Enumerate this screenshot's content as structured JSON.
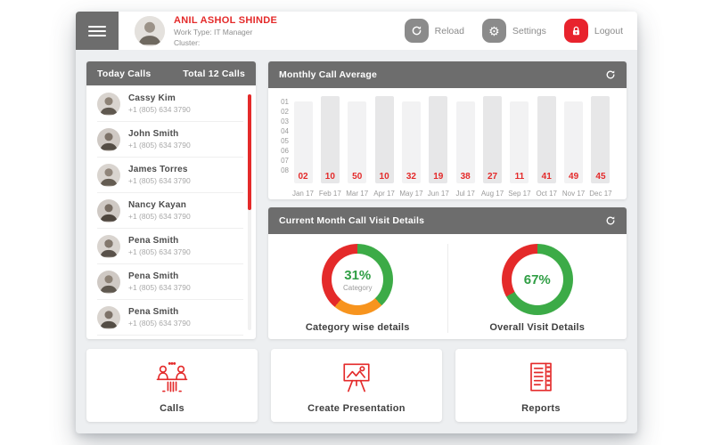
{
  "colors": {
    "accent_red": "#e42a2a",
    "logout_red": "#e8232d",
    "panel_header_gray": "#6d6d6d",
    "green": "#3cab47",
    "orange": "#f7941e",
    "body_bg": "#edeff1"
  },
  "header": {
    "user": {
      "name": "ANIL ASHOL SHINDE",
      "work_type": "Work Type: IT Manager",
      "cluster": "Cluster:"
    },
    "reload_label": "Reload",
    "settings_label": "Settings",
    "logout_label": "Logout"
  },
  "today_calls": {
    "title": "Today Calls",
    "total_label": "Total 12 Calls",
    "contacts": [
      {
        "name": "Cassy Kim",
        "phone": "+1 (805) 634 3790"
      },
      {
        "name": "John Smith",
        "phone": "+1 (805) 634 3790"
      },
      {
        "name": "James Torres",
        "phone": "+1 (805) 634 3790"
      },
      {
        "name": "Nancy Kayan",
        "phone": "+1 (805) 634 3790"
      },
      {
        "name": "Pena Smith",
        "phone": "+1 (805) 634 3790"
      },
      {
        "name": "Pena Smith",
        "phone": "+1 (805) 634 3790"
      },
      {
        "name": "Pena Smith",
        "phone": "+1 (805) 634 3790"
      }
    ]
  },
  "visit_details": {
    "title": "Current Month Call Visit Details"
  },
  "chart_data": [
    {
      "type": "bar",
      "title": "Monthly Call Average",
      "categories": [
        "Jan 17",
        "Feb 17",
        "Mar 17",
        "Apr 17",
        "May 17",
        "Jun 17",
        "Jul 17",
        "Aug 17",
        "Sep 17",
        "Oct 17",
        "Nov 17",
        "Dec 17"
      ],
      "values": [
        2,
        10,
        50,
        10,
        32,
        19,
        38,
        27,
        11,
        41,
        49,
        45
      ],
      "value_labels": [
        "02",
        "10",
        "50",
        "10",
        "32",
        "19",
        "38",
        "27",
        "11",
        "41",
        "49",
        "45"
      ],
      "y_ticks": [
        "01",
        "02",
        "03",
        "04",
        "05",
        "06",
        "07",
        "08"
      ],
      "xlabel": "",
      "ylabel": "",
      "legend_position": "none",
      "grid": false
    },
    {
      "type": "pie",
      "title": "Category wise details",
      "center_label": "31%",
      "center_sub": "Category",
      "slices": [
        {
          "label": "green segment",
          "value": 38,
          "color": "#3cab47"
        },
        {
          "label": "orange segment",
          "value": 23,
          "color": "#f7941e"
        },
        {
          "label": "red segment",
          "value": 39,
          "color": "#e42a2a"
        }
      ]
    },
    {
      "type": "pie",
      "title": "Overall Visit Details",
      "center_label": "67%",
      "center_sub": "",
      "slices": [
        {
          "label": "green segment",
          "value": 67,
          "color": "#3cab47"
        },
        {
          "label": "red segment",
          "value": 33,
          "color": "#e42a2a"
        }
      ]
    }
  ],
  "quick_actions": [
    {
      "label": "Calls",
      "icon": "meeting-icon"
    },
    {
      "label": "Create Presentation",
      "icon": "presentation-icon"
    },
    {
      "label": "Reports",
      "icon": "reports-icon"
    }
  ]
}
